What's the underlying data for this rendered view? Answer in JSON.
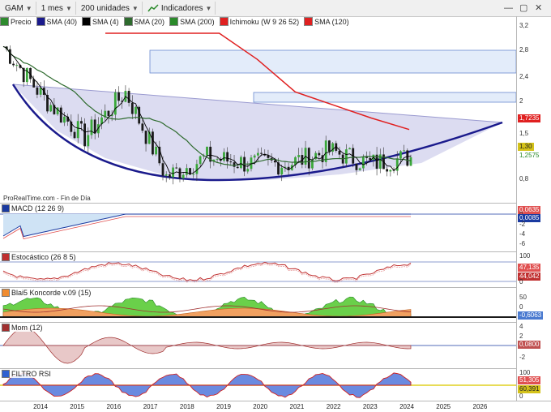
{
  "toolbar": {
    "symbol": "GAM",
    "timeframe": "1 mes",
    "units": "200 unidades",
    "indicators": "Indicadores",
    "minimize": "—",
    "restore": "▢",
    "close": "✕"
  },
  "legend": [
    {
      "label": "Precio",
      "color": "#2e8b2e"
    },
    {
      "label": "SMA (40)",
      "color": "#1a1a8c"
    },
    {
      "label": "SMA (4)",
      "color": "#000000"
    },
    {
      "label": "SMA (20)",
      "color": "#2e6b2e"
    },
    {
      "label": "SMA (200)",
      "color": "#2a8a2a"
    },
    {
      "label": "Ichimoku (W 9 26 52)",
      "color": "#e02020"
    },
    {
      "label": "SMA (120)",
      "color": "#e02020"
    }
  ],
  "source": "ProRealTime.com - Fin de Día",
  "panels": {
    "macd": {
      "title": "MACD (12 26 9)",
      "color": "#1a3aa0"
    },
    "stoch": {
      "title": "Estocástico (26 8 5)",
      "color": "#c03030"
    },
    "blai": {
      "title": "Blai5 Koncorde v.09 (15)",
      "color": "#f08c30"
    },
    "mom": {
      "title": "Mom (12)",
      "color": "#a03030"
    },
    "rsi": {
      "title": "FILTRO RSI",
      "color": "#3060d0"
    }
  },
  "axes": {
    "price": [
      "3,2",
      "2,8",
      "2,4",
      "2",
      "1,5",
      "1,2575",
      "0,8"
    ],
    "macd": [
      "0",
      "-2",
      "-4",
      "-6"
    ],
    "stoch": [
      "100",
      "0"
    ],
    "blai": [
      "50",
      "0"
    ],
    "mom": [
      "4",
      "2",
      "0",
      "-2"
    ],
    "rsi": [
      "100",
      "50",
      "0"
    ]
  },
  "tags": {
    "price_red": {
      "text": "1,7235",
      "color": "#e02020"
    },
    "price_last": {
      "text": "1,30",
      "color": "#d4c21a"
    },
    "price_green": {
      "text": "1,2575",
      "color": "#2a8a2a"
    },
    "macd_a": {
      "text": "0,0635",
      "color": "#e05050"
    },
    "macd_b": {
      "text": "0,0085",
      "color": "#1a3aa0"
    },
    "stoch_a": {
      "text": "47,135",
      "color": "#e05050"
    },
    "stoch_b": {
      "text": "44,042",
      "color": "#c03030"
    },
    "blai": {
      "text": "-0,6063",
      "color": "#4a7ad0"
    },
    "mom": {
      "text": "0,0800",
      "color": "#c05050"
    },
    "rsi_a": {
      "text": "51,305",
      "color": "#e05050"
    },
    "rsi_b": {
      "text": "60,391",
      "color": "#d4c21a"
    }
  },
  "chart_data": {
    "type": "line",
    "title": "GAM",
    "x": [
      "2014",
      "2015",
      "2016",
      "2017",
      "2018",
      "2019",
      "2020",
      "2021",
      "2022",
      "2023",
      "2024",
      "2025",
      "2026"
    ],
    "price_close": [
      3.0,
      2.2,
      1.6,
      2.3,
      1.0,
      1.3,
      1.2,
      1.2,
      1.4,
      1.2,
      1.3
    ],
    "series": [
      {
        "name": "SMA (120)",
        "values": [
          3.2,
          3.2,
          3.2,
          3.2,
          2.8,
          2.3,
          2.1,
          1.9,
          1.7235
        ]
      },
      {
        "name": "SMA (40)",
        "values": [
          2.9,
          2.6,
          2.2,
          1.9,
          1.6,
          1.4,
          1.3,
          1.25,
          1.2575
        ]
      }
    ],
    "resistance_zones": [
      [
        2.45,
        2.8
      ],
      [
        1.9,
        2.05
      ]
    ],
    "ylim": [
      0.6,
      3.3
    ],
    "grid": false,
    "legend": "top-left"
  }
}
